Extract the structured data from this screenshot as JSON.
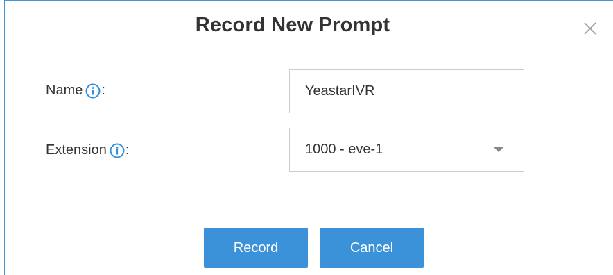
{
  "dialog": {
    "title": "Record New Prompt"
  },
  "form": {
    "name": {
      "label": "Name",
      "colon": ":",
      "value": "YeastarIVR"
    },
    "extension": {
      "label": "Extension",
      "colon": ":",
      "selected": "1000 - eve-1"
    }
  },
  "buttons": {
    "record_label": "Record",
    "cancel_label": "Cancel"
  },
  "icons": {
    "info": "info-circle-icon",
    "close": "close-icon",
    "dropdown": "caret-down-icon"
  },
  "colors": {
    "accent": "#3c92d9",
    "info_icon": "#2e8fe0"
  }
}
